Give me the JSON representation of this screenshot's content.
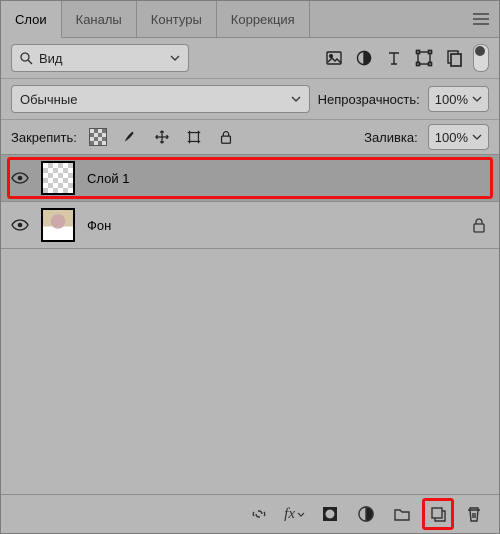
{
  "tabs": {
    "items": [
      "Слои",
      "Каналы",
      "Контуры",
      "Коррекция"
    ],
    "active": 0
  },
  "row2": {
    "kind_label": "Вид"
  },
  "row3": {
    "blend_mode": "Обычные",
    "opacity_label": "Непрозрачность:",
    "opacity_value": "100%"
  },
  "row4": {
    "lock_label": "Закрепить:",
    "fill_label": "Заливка:",
    "fill_value": "100%"
  },
  "layers": [
    {
      "name": "Слой 1",
      "visible": true,
      "selected": true,
      "thumb": "trans",
      "locked": false,
      "highlight": true
    },
    {
      "name": "Фон",
      "visible": true,
      "selected": false,
      "thumb": "photo",
      "locked": true,
      "highlight": false
    }
  ],
  "footer": {
    "highlight_new_layer": true
  }
}
